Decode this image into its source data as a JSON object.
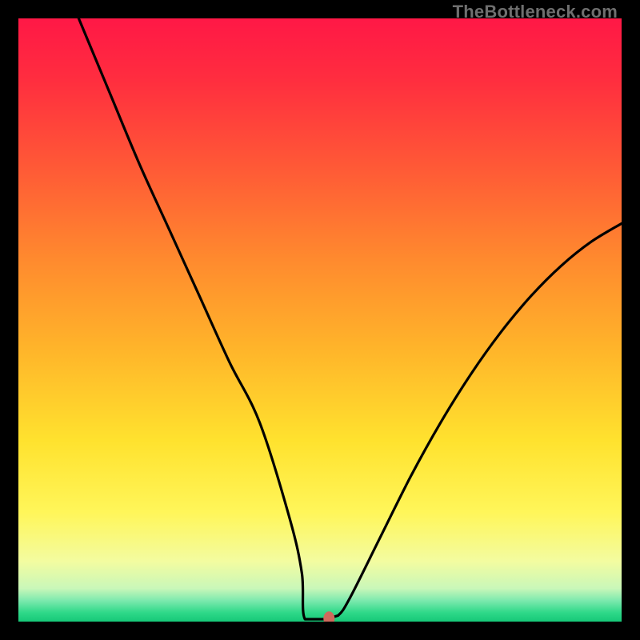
{
  "watermark": "TheBottleneck.com",
  "chart_data": {
    "type": "line",
    "title": "",
    "xlabel": "",
    "ylabel": "",
    "xlim": [
      0,
      100
    ],
    "ylim": [
      0,
      100
    ],
    "series": [
      {
        "name": "curve",
        "x": [
          10,
          15,
          20,
          25,
          30,
          35,
          40,
          45,
          47,
          49,
          51,
          53,
          55,
          60,
          65,
          70,
          75,
          80,
          85,
          90,
          95,
          100
        ],
        "y": [
          100,
          88,
          76,
          65,
          54,
          43,
          33,
          17,
          8,
          1,
          0,
          1,
          4,
          14,
          24,
          33,
          41,
          48,
          54,
          59,
          63,
          66
        ]
      }
    ],
    "marker": {
      "x": 51.5,
      "y": 0.5
    },
    "flat_segment": {
      "x0": 47.5,
      "x1": 51,
      "y": 0.4
    },
    "gradient_stops": [
      {
        "offset": 0.0,
        "color": "#ff1846"
      },
      {
        "offset": 0.1,
        "color": "#ff2d3f"
      },
      {
        "offset": 0.25,
        "color": "#ff5a36"
      },
      {
        "offset": 0.4,
        "color": "#ff8a2e"
      },
      {
        "offset": 0.55,
        "color": "#ffb52a"
      },
      {
        "offset": 0.7,
        "color": "#ffe22e"
      },
      {
        "offset": 0.82,
        "color": "#fff65a"
      },
      {
        "offset": 0.9,
        "color": "#f3fca0"
      },
      {
        "offset": 0.945,
        "color": "#c9f7b9"
      },
      {
        "offset": 0.965,
        "color": "#7de9ae"
      },
      {
        "offset": 0.985,
        "color": "#2fd989"
      },
      {
        "offset": 1.0,
        "color": "#16c878"
      }
    ],
    "marker_color": "#cf6a5c",
    "curve_color": "#000000"
  }
}
